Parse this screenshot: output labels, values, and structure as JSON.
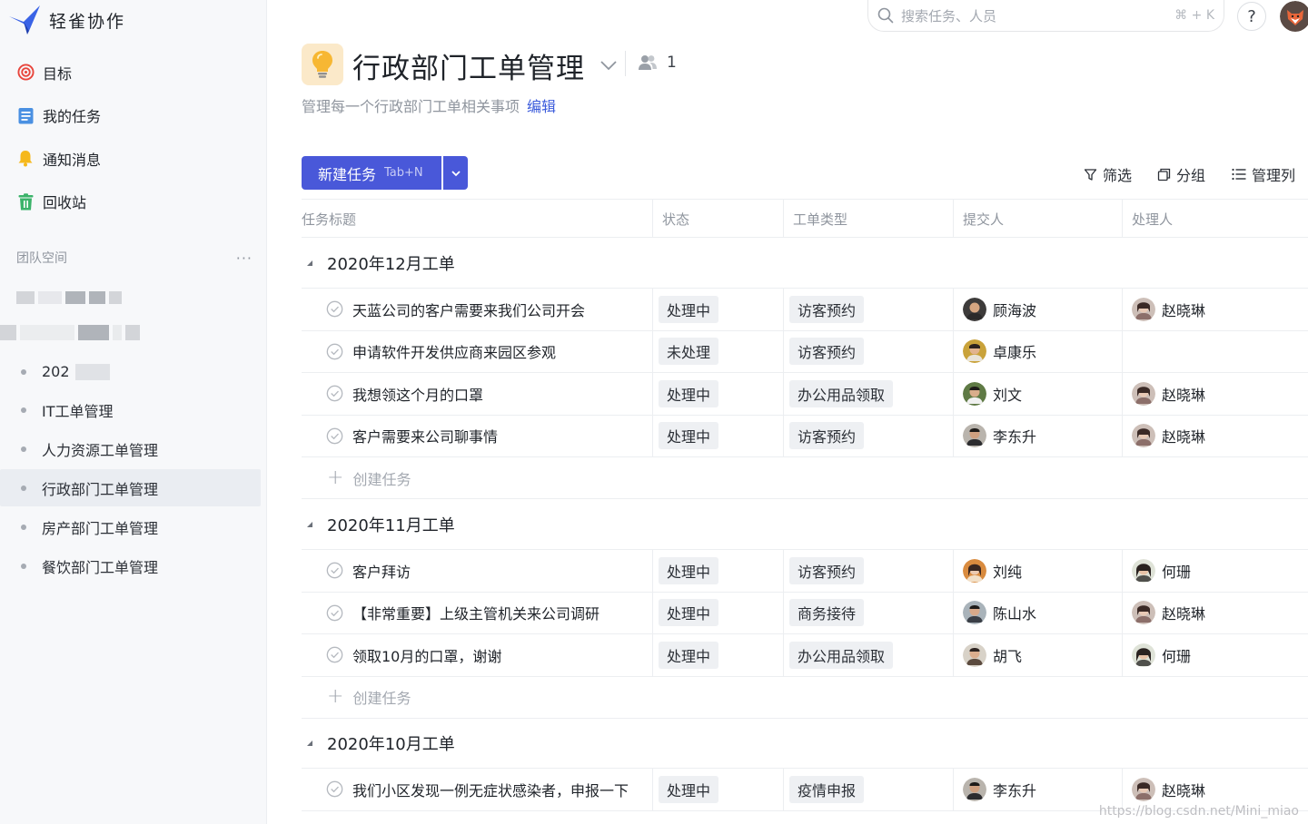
{
  "app": {
    "name": "轻雀协作"
  },
  "sidebar": {
    "nav": [
      {
        "label": "目标",
        "icon": "target-icon"
      },
      {
        "label": "我的任务",
        "icon": "task-list-icon"
      },
      {
        "label": "通知消息",
        "icon": "bell-icon"
      },
      {
        "label": "回收站",
        "icon": "trash-icon"
      }
    ],
    "team_label": "团队空间",
    "team_more": "···",
    "projects": [
      {
        "label": "IT工单管理"
      },
      {
        "label": "人力资源工单管理"
      },
      {
        "label": "行政部门工单管理",
        "active": true
      },
      {
        "label": "房产部门工单管理"
      },
      {
        "label": "餐饮部门工单管理"
      }
    ],
    "partial_item": "202"
  },
  "topbar": {
    "search_placeholder": "搜索任务、人员",
    "search_shortcut": "⌘ + K",
    "help": "?"
  },
  "header": {
    "title": "行政部门工单管理",
    "member_count": "1",
    "description": "管理每一个行政部门工单相关事项",
    "edit_label": "编辑"
  },
  "toolbar": {
    "new_task": "新建任务",
    "new_task_shortcut": "Tab+N",
    "filter": "筛选",
    "group": "分组",
    "columns": "管理列"
  },
  "table": {
    "columns": [
      "任务标题",
      "状态",
      "工单类型",
      "提交人",
      "处理人"
    ],
    "create_label": "创建任务",
    "groups": [
      {
        "name": "2020年12月工单",
        "rows": [
          {
            "title": "天蓝公司的客户需要来我们公司开会",
            "status": "处理中",
            "type": "访客预约",
            "submitter": "顾海波",
            "handler": "赵晓琳"
          },
          {
            "title": "申请软件开发供应商来园区参观",
            "status": "未处理",
            "type": "访客预约",
            "submitter": "卓康乐",
            "handler": ""
          },
          {
            "title": "我想领这个月的口罩",
            "status": "处理中",
            "type": "办公用品领取",
            "submitter": "刘文",
            "handler": "赵晓琳"
          },
          {
            "title": "客户需要来公司聊事情",
            "status": "处理中",
            "type": "访客预约",
            "submitter": "李东升",
            "handler": "赵晓琳"
          }
        ]
      },
      {
        "name": "2020年11月工单",
        "rows": [
          {
            "title": "客户拜访",
            "status": "处理中",
            "type": "访客预约",
            "submitter": "刘纯",
            "handler": "何珊"
          },
          {
            "title": "【非常重要】上级主管机关来公司调研",
            "status": "处理中",
            "type": "商务接待",
            "submitter": "陈山水",
            "handler": "赵晓琳"
          },
          {
            "title": "领取10月的口罩，谢谢",
            "status": "处理中",
            "type": "办公用品领取",
            "submitter": "胡飞",
            "handler": "何珊"
          }
        ]
      },
      {
        "name": "2020年10月工单",
        "rows": [
          {
            "title": "我们小区发现一例无症状感染者，申报一下",
            "status": "处理中",
            "type": "疫情申报",
            "submitter": "李东升",
            "handler": "赵晓琳"
          }
        ]
      }
    ]
  },
  "watermark": "https://blog.csdn.net/Mini_miao",
  "colors": {
    "accent": "#4958d9",
    "link": "#3b5bdb",
    "tag_bg": "#eef0f3"
  }
}
